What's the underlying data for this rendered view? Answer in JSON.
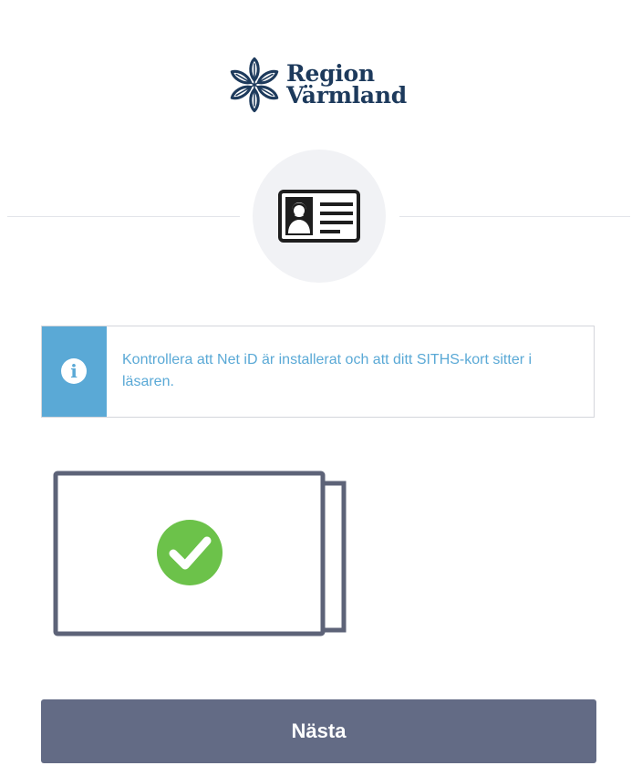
{
  "logo": {
    "line1": "Region",
    "line2": "Värmland",
    "icon": "flower-star-icon"
  },
  "id_icon": "id-card-icon",
  "info": {
    "icon": "info-icon",
    "icon_glyph": "i",
    "message": "Kontrollera att Net iD är installerat och att ditt SITHS-kort sitter i läsaren."
  },
  "card_status": {
    "icon": "checkmark-icon",
    "state": "inserted"
  },
  "next_button": {
    "label": "Nästa"
  },
  "colors": {
    "brand": "#1d3a5c",
    "info_accent": "#5aa9d6",
    "button": "#636b85",
    "success": "#6cc24a",
    "card_outline": "#5d6378"
  }
}
